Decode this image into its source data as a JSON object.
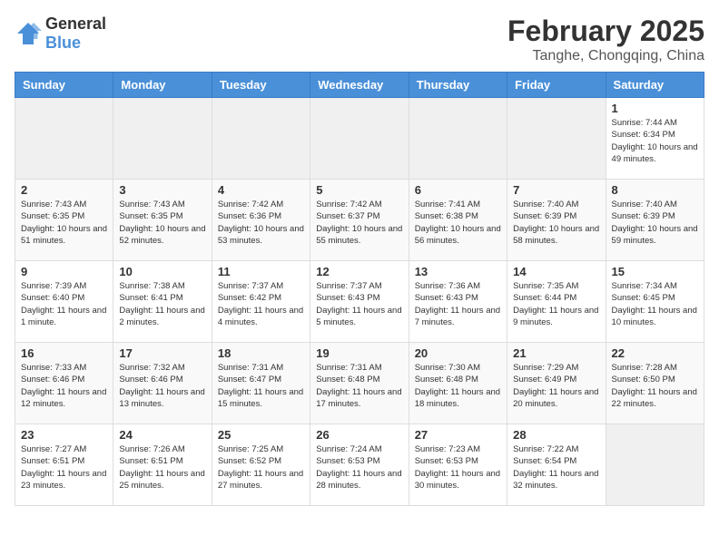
{
  "header": {
    "logo_general": "General",
    "logo_blue": "Blue",
    "month_title": "February 2025",
    "location": "Tanghe, Chongqing, China"
  },
  "weekdays": [
    "Sunday",
    "Monday",
    "Tuesday",
    "Wednesday",
    "Thursday",
    "Friday",
    "Saturday"
  ],
  "weeks": [
    [
      {
        "day": "",
        "info": ""
      },
      {
        "day": "",
        "info": ""
      },
      {
        "day": "",
        "info": ""
      },
      {
        "day": "",
        "info": ""
      },
      {
        "day": "",
        "info": ""
      },
      {
        "day": "",
        "info": ""
      },
      {
        "day": "1",
        "info": "Sunrise: 7:44 AM\nSunset: 6:34 PM\nDaylight: 10 hours and 49 minutes."
      }
    ],
    [
      {
        "day": "2",
        "info": "Sunrise: 7:43 AM\nSunset: 6:35 PM\nDaylight: 10 hours and 51 minutes."
      },
      {
        "day": "3",
        "info": "Sunrise: 7:43 AM\nSunset: 6:35 PM\nDaylight: 10 hours and 52 minutes."
      },
      {
        "day": "4",
        "info": "Sunrise: 7:42 AM\nSunset: 6:36 PM\nDaylight: 10 hours and 53 minutes."
      },
      {
        "day": "5",
        "info": "Sunrise: 7:42 AM\nSunset: 6:37 PM\nDaylight: 10 hours and 55 minutes."
      },
      {
        "day": "6",
        "info": "Sunrise: 7:41 AM\nSunset: 6:38 PM\nDaylight: 10 hours and 56 minutes."
      },
      {
        "day": "7",
        "info": "Sunrise: 7:40 AM\nSunset: 6:39 PM\nDaylight: 10 hours and 58 minutes."
      },
      {
        "day": "8",
        "info": "Sunrise: 7:40 AM\nSunset: 6:39 PM\nDaylight: 10 hours and 59 minutes."
      }
    ],
    [
      {
        "day": "9",
        "info": "Sunrise: 7:39 AM\nSunset: 6:40 PM\nDaylight: 11 hours and 1 minute."
      },
      {
        "day": "10",
        "info": "Sunrise: 7:38 AM\nSunset: 6:41 PM\nDaylight: 11 hours and 2 minutes."
      },
      {
        "day": "11",
        "info": "Sunrise: 7:37 AM\nSunset: 6:42 PM\nDaylight: 11 hours and 4 minutes."
      },
      {
        "day": "12",
        "info": "Sunrise: 7:37 AM\nSunset: 6:43 PM\nDaylight: 11 hours and 5 minutes."
      },
      {
        "day": "13",
        "info": "Sunrise: 7:36 AM\nSunset: 6:43 PM\nDaylight: 11 hours and 7 minutes."
      },
      {
        "day": "14",
        "info": "Sunrise: 7:35 AM\nSunset: 6:44 PM\nDaylight: 11 hours and 9 minutes."
      },
      {
        "day": "15",
        "info": "Sunrise: 7:34 AM\nSunset: 6:45 PM\nDaylight: 11 hours and 10 minutes."
      }
    ],
    [
      {
        "day": "16",
        "info": "Sunrise: 7:33 AM\nSunset: 6:46 PM\nDaylight: 11 hours and 12 minutes."
      },
      {
        "day": "17",
        "info": "Sunrise: 7:32 AM\nSunset: 6:46 PM\nDaylight: 11 hours and 13 minutes."
      },
      {
        "day": "18",
        "info": "Sunrise: 7:31 AM\nSunset: 6:47 PM\nDaylight: 11 hours and 15 minutes."
      },
      {
        "day": "19",
        "info": "Sunrise: 7:31 AM\nSunset: 6:48 PM\nDaylight: 11 hours and 17 minutes."
      },
      {
        "day": "20",
        "info": "Sunrise: 7:30 AM\nSunset: 6:48 PM\nDaylight: 11 hours and 18 minutes."
      },
      {
        "day": "21",
        "info": "Sunrise: 7:29 AM\nSunset: 6:49 PM\nDaylight: 11 hours and 20 minutes."
      },
      {
        "day": "22",
        "info": "Sunrise: 7:28 AM\nSunset: 6:50 PM\nDaylight: 11 hours and 22 minutes."
      }
    ],
    [
      {
        "day": "23",
        "info": "Sunrise: 7:27 AM\nSunset: 6:51 PM\nDaylight: 11 hours and 23 minutes."
      },
      {
        "day": "24",
        "info": "Sunrise: 7:26 AM\nSunset: 6:51 PM\nDaylight: 11 hours and 25 minutes."
      },
      {
        "day": "25",
        "info": "Sunrise: 7:25 AM\nSunset: 6:52 PM\nDaylight: 11 hours and 27 minutes."
      },
      {
        "day": "26",
        "info": "Sunrise: 7:24 AM\nSunset: 6:53 PM\nDaylight: 11 hours and 28 minutes."
      },
      {
        "day": "27",
        "info": "Sunrise: 7:23 AM\nSunset: 6:53 PM\nDaylight: 11 hours and 30 minutes."
      },
      {
        "day": "28",
        "info": "Sunrise: 7:22 AM\nSunset: 6:54 PM\nDaylight: 11 hours and 32 minutes."
      },
      {
        "day": "",
        "info": ""
      }
    ]
  ]
}
